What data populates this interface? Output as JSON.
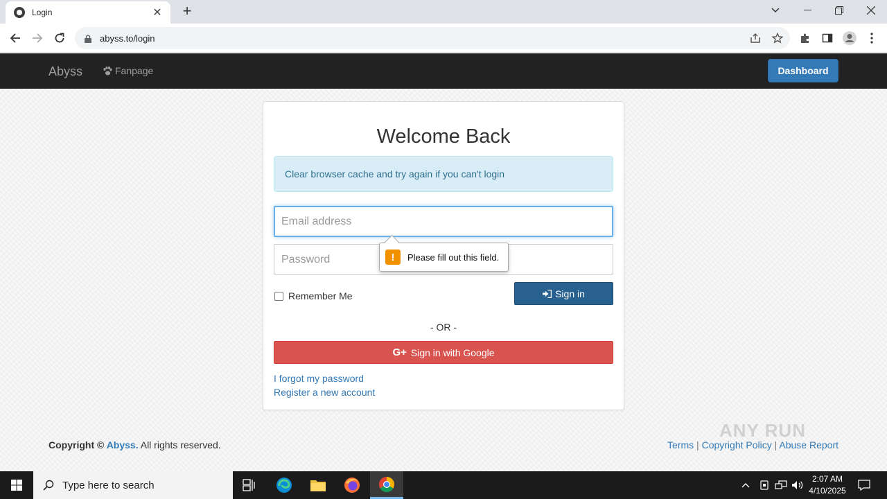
{
  "browser": {
    "tab_title": "Login",
    "url": "abyss.to/login"
  },
  "navbar": {
    "brand": "Abyss",
    "fanpage": "Fanpage",
    "dashboard": "Dashboard"
  },
  "login": {
    "title": "Welcome Back",
    "alert": "Clear browser cache and try again if you can't login",
    "email_placeholder": "Email address",
    "email_value": "",
    "password_placeholder": "Password",
    "password_value": "",
    "validation_message": "Please fill out this field.",
    "remember_label": "Remember Me",
    "remember_checked": false,
    "signin_label": "Sign in",
    "or_label": "- OR -",
    "google_label": "Sign in with Google",
    "forgot_link": "I forgot my password",
    "register_link": "Register a new account"
  },
  "footer": {
    "copyright_prefix": "Copyright ©",
    "brand": "Abyss.",
    "rights": "All rights reserved.",
    "links": [
      "Terms",
      "Copyright Policy",
      "Abuse Report"
    ],
    "separator": "|"
  },
  "watermark": "ANY RUN",
  "taskbar": {
    "search_placeholder": "Type here to search",
    "time": "2:07 AM",
    "date": "4/10/2025"
  },
  "colors": {
    "primary": "#337ab7",
    "signin": "#286090",
    "google": "#d9534f",
    "navbar": "#222222",
    "alert_bg": "#d9edf7",
    "warning": "#f29100"
  }
}
